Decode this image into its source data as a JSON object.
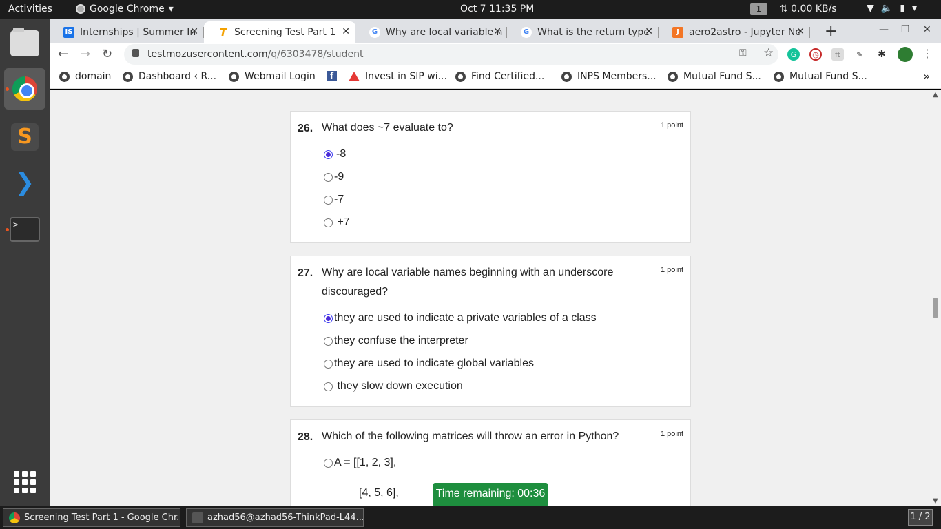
{
  "topbar": {
    "activities": "Activities",
    "app_name": "Google Chrome",
    "clock": "Oct 7  11:35 PM",
    "workspace": "1",
    "net_speed": "⇅ 0.00 KB/s"
  },
  "dock": {
    "items": [
      "files",
      "google-chrome",
      "sublime-text",
      "vscode",
      "terminal"
    ],
    "term_prompt": ">_"
  },
  "tabs": [
    {
      "title": "Internships | Summer In",
      "favicon": "IS",
      "color": "#1a73e8"
    },
    {
      "title": "Screening Test Part 1",
      "favicon": "T",
      "color": "#f4a100"
    },
    {
      "title": "Why are local variable n",
      "favicon": "G",
      "color": "#4285f4"
    },
    {
      "title": "What is the return type",
      "favicon": "G",
      "color": "#4285f4"
    },
    {
      "title": "aero2astro - Jupyter No",
      "favicon": "J",
      "color": "#f37626"
    }
  ],
  "address": {
    "host": "testmozusercontent.com",
    "path": "/q/6303478/student"
  },
  "bookmarks": [
    {
      "label": "domain",
      "icon": "globe"
    },
    {
      "label": "Dashboard ‹ R...",
      "icon": "globe"
    },
    {
      "label": "Webmail Login",
      "icon": "globe"
    },
    {
      "label": "",
      "icon": "facebook"
    },
    {
      "label": "Invest in SIP wi...",
      "icon": "triangle"
    },
    {
      "label": "Find Certified...",
      "icon": "globe"
    },
    {
      "label": "INPS Members...",
      "icon": "globe"
    },
    {
      "label": "Mutual Fund S...",
      "icon": "globe"
    },
    {
      "label": "Mutual Fund S...",
      "icon": "globe"
    }
  ],
  "questions": [
    {
      "number": "26.",
      "text": "What does ~7 evaluate to?",
      "points": "1 point",
      "options": [
        "-8",
        "-9",
        "-7",
        " +7"
      ],
      "selected": 0
    },
    {
      "number": "27.",
      "text": "Why are local variable names beginning with an underscore discouraged?",
      "points": "1 point",
      "options": [
        "they are used to indicate a private variables of a class",
        "they confuse the interpreter",
        "they are used to indicate global variables",
        " they slow down execution"
      ],
      "selected": 0
    },
    {
      "number": "28.",
      "text": "Which of the following matrices will throw an error in Python?",
      "points": "1 point",
      "options": [
        "A = [[1, 2, 3],"
      ],
      "code_line": "[4, 5, 6],",
      "selected": -1
    }
  ],
  "timer": "Time remaining: 00:36",
  "taskbar": {
    "chrome_task": "Screening Test Part 1 - Google Chr...",
    "terminal_task": "azhad56@azhad56-ThinkPad-L44...",
    "pager": "1 / 2"
  }
}
